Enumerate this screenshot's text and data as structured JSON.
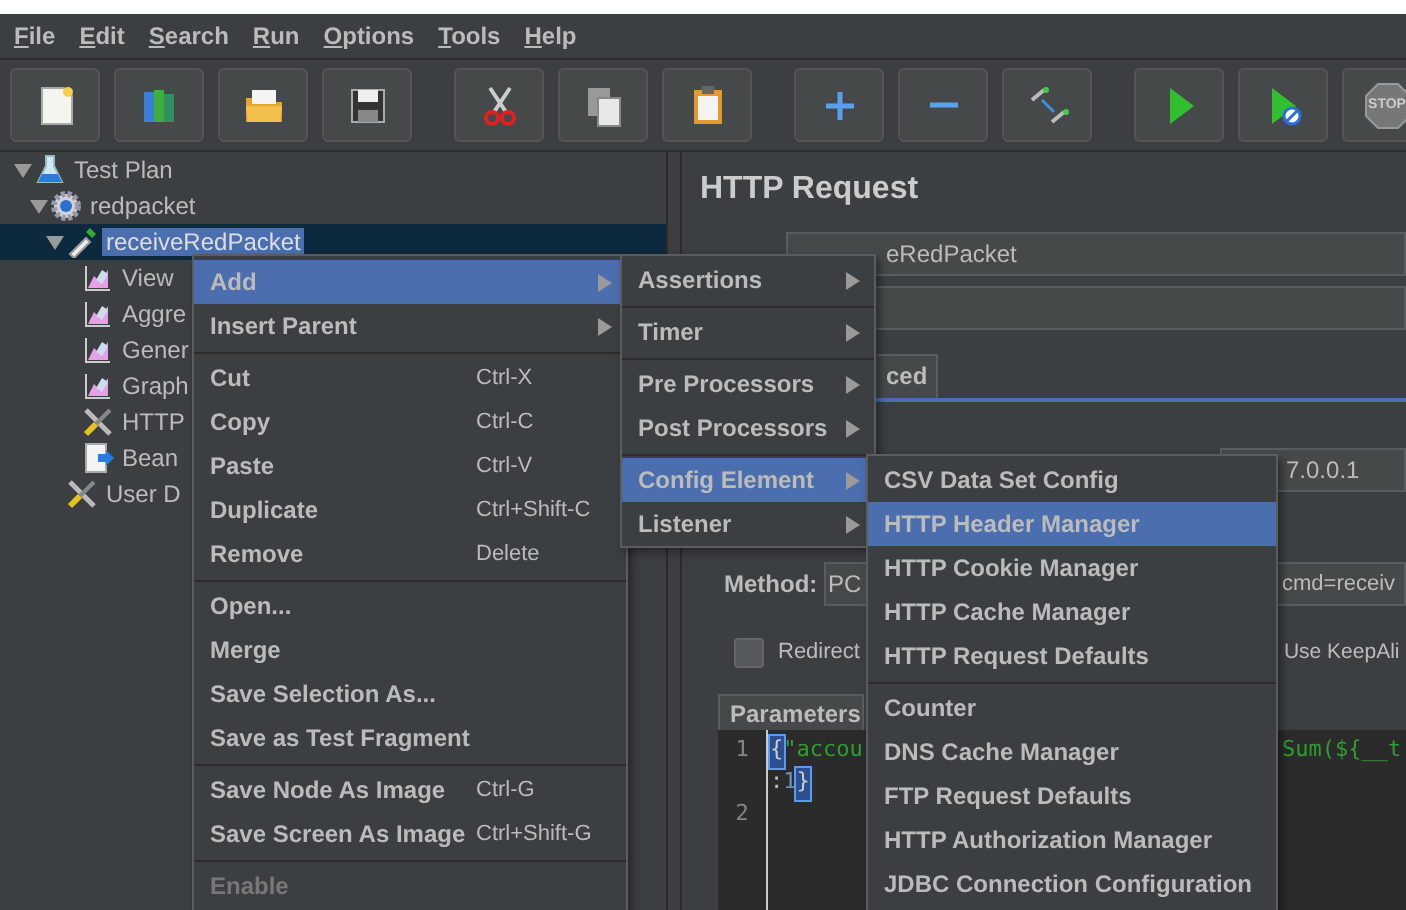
{
  "menubar": [
    "File",
    "Edit",
    "Search",
    "Run",
    "Options",
    "Tools",
    "Help"
  ],
  "toolbar": {
    "stop_text": "STOP"
  },
  "tree": [
    {
      "label": "Test Plan",
      "kind": "flask",
      "expanded": true,
      "selected": false,
      "children": [
        {
          "label": "redpacket",
          "kind": "gear",
          "expanded": true,
          "selected": false,
          "children": [
            {
              "label": "receiveRedPacket",
              "kind": "dropper",
              "expanded": true,
              "selected": true,
              "children": [
                {
                  "label": "View",
                  "kind": "chart",
                  "selected": false
                },
                {
                  "label": "Aggre",
                  "kind": "chart",
                  "selected": false
                },
                {
                  "label": "Gener",
                  "kind": "chart",
                  "selected": false
                },
                {
                  "label": "Graph",
                  "kind": "chart",
                  "selected": false
                },
                {
                  "label": "HTTP",
                  "kind": "tools",
                  "selected": false
                },
                {
                  "label": "Bean",
                  "kind": "script",
                  "selected": false
                }
              ]
            },
            {
              "label": "User D",
              "kind": "tools",
              "selected": false
            }
          ]
        }
      ]
    }
  ],
  "panel": {
    "title": "HTTP Request",
    "name_value": "eRedPacket",
    "tab_label": "ced",
    "server_value": "7.0.0.1",
    "method_label": "Method:",
    "method_value": "PC",
    "path_value": "cmd=receiv",
    "redirect": {
      "label": "Redirect",
      "checked": false
    },
    "keepalive_label": "Use KeepAli",
    "params_tab": "Parameters",
    "code": [
      {
        "number": "1",
        "tokens": [
          {
            "kind": "bracket",
            "text": "{"
          },
          {
            "kind": "string",
            "text": "\"accou"
          }
        ],
        "right_tokens": [
          {
            "kind": "string",
            "text": "Sum(${__t"
          }
        ]
      },
      {
        "tokens": [
          {
            "kind": "plain",
            "text": ":"
          },
          {
            "kind": "number",
            "text": "1"
          },
          {
            "kind": "bracket",
            "text": "}"
          }
        ]
      },
      {
        "number": "2"
      }
    ]
  },
  "context_menu": [
    {
      "kind": "submenu",
      "label": "Add",
      "selected": true,
      "disabled": false
    },
    {
      "kind": "submenu",
      "label": "Insert Parent",
      "selected": false,
      "disabled": false
    },
    {
      "kind": "separator"
    },
    {
      "kind": "item",
      "label": "Cut",
      "shortcut": "Ctrl-X",
      "selected": false,
      "disabled": false
    },
    {
      "kind": "item",
      "label": "Copy",
      "shortcut": "Ctrl-C",
      "selected": false,
      "disabled": false
    },
    {
      "kind": "item",
      "label": "Paste",
      "shortcut": "Ctrl-V",
      "selected": false,
      "disabled": false
    },
    {
      "kind": "item",
      "label": "Duplicate",
      "shortcut": "Ctrl+Shift-C",
      "selected": false,
      "disabled": false
    },
    {
      "kind": "item",
      "label": "Remove",
      "shortcut": "Delete",
      "selected": false,
      "disabled": false
    },
    {
      "kind": "separator"
    },
    {
      "kind": "item",
      "label": "Open...",
      "selected": false,
      "disabled": false
    },
    {
      "kind": "item",
      "label": "Merge",
      "selected": false,
      "disabled": false
    },
    {
      "kind": "item",
      "label": "Save Selection As...",
      "selected": false,
      "disabled": false
    },
    {
      "kind": "item",
      "label": "Save as Test Fragment",
      "selected": false,
      "disabled": false
    },
    {
      "kind": "separator"
    },
    {
      "kind": "item",
      "label": "Save Node As Image",
      "shortcut": "Ctrl-G",
      "selected": false,
      "disabled": false
    },
    {
      "kind": "item",
      "label": "Save Screen As Image",
      "shortcut": "Ctrl+Shift-G",
      "selected": false,
      "disabled": false
    },
    {
      "kind": "separator"
    },
    {
      "kind": "item",
      "label": "Enable",
      "selected": false,
      "disabled": true
    }
  ],
  "add_submenu": [
    {
      "kind": "submenu",
      "label": "Assertions",
      "selected": false
    },
    {
      "kind": "separator"
    },
    {
      "kind": "submenu",
      "label": "Timer",
      "selected": false
    },
    {
      "kind": "separator"
    },
    {
      "kind": "submenu",
      "label": "Pre Processors",
      "selected": false
    },
    {
      "kind": "submenu",
      "label": "Post Processors",
      "selected": false
    },
    {
      "kind": "separator"
    },
    {
      "kind": "submenu",
      "label": "Config Element",
      "selected": true
    },
    {
      "kind": "submenu",
      "label": "Listener",
      "selected": false
    }
  ],
  "config_submenu": [
    {
      "kind": "item",
      "label": "CSV Data Set Config",
      "selected": false
    },
    {
      "kind": "item",
      "label": "HTTP Header Manager",
      "selected": true
    },
    {
      "kind": "item",
      "label": "HTTP Cookie Manager",
      "selected": false
    },
    {
      "kind": "item",
      "label": "HTTP Cache Manager",
      "selected": false
    },
    {
      "kind": "item",
      "label": "HTTP Request Defaults",
      "selected": false
    },
    {
      "kind": "separator"
    },
    {
      "kind": "item",
      "label": "Counter",
      "selected": false
    },
    {
      "kind": "item",
      "label": "DNS Cache Manager",
      "selected": false
    },
    {
      "kind": "item",
      "label": "FTP Request Defaults",
      "selected": false
    },
    {
      "kind": "item",
      "label": "HTTP Authorization Manager",
      "selected": false
    },
    {
      "kind": "item",
      "label": "JDBC Connection Configuration",
      "selected": false
    }
  ]
}
